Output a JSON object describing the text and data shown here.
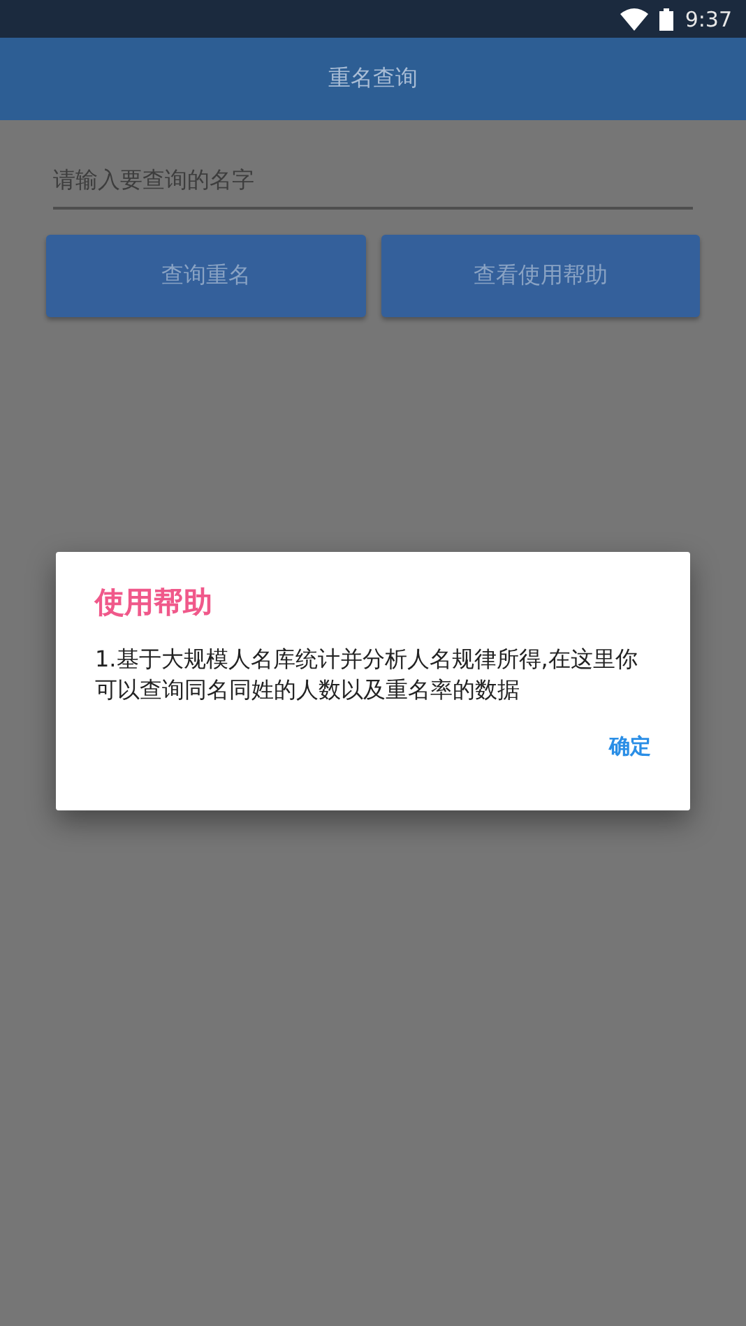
{
  "status_bar": {
    "time": "9:37"
  },
  "app_bar": {
    "title": "重名查询"
  },
  "search": {
    "placeholder": "请输入要查询的名字"
  },
  "buttons": [
    {
      "label": "查询重名"
    },
    {
      "label": "查看使用帮助"
    }
  ],
  "dialog": {
    "title": "使用帮助",
    "message": "1.基于大规模人名库统计并分析人名规律所得,在这里你可以查询同名同姓的人数以及重名率的数据",
    "confirm": "确定"
  }
}
